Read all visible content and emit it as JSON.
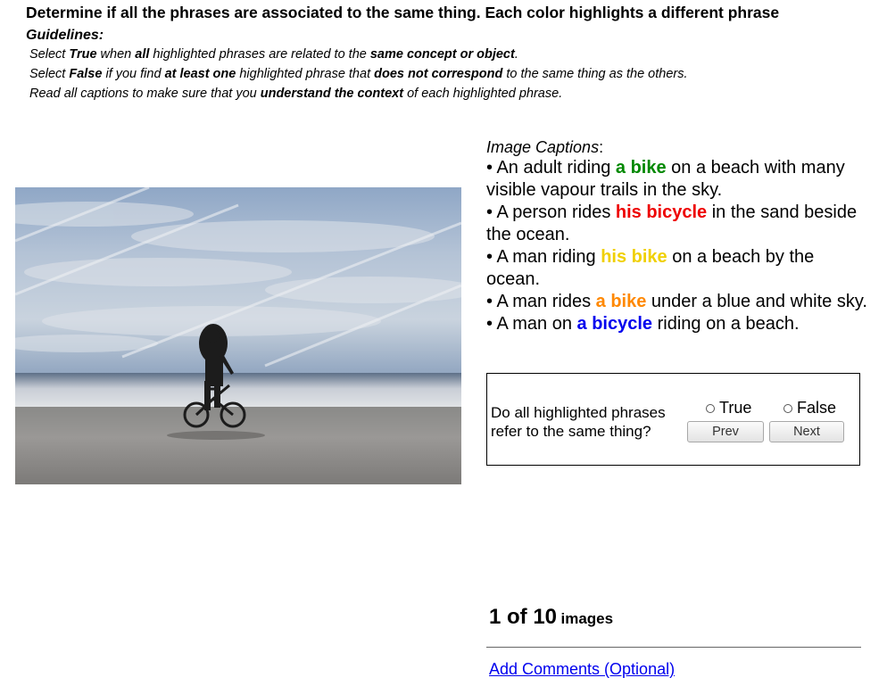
{
  "header": {
    "title": "Determine if all the phrases are associated to the same thing. Each color highlights a different phrase",
    "guidelines_label": "Guidelines:"
  },
  "guidelines": {
    "line1": {
      "a": "Select ",
      "b": "True",
      "c": " when ",
      "d": "all",
      "e": " highlighted phrases are related to the ",
      "f": "same concept or object",
      "g": "."
    },
    "line2": {
      "a": "Select ",
      "b": "False",
      "c": " if you find ",
      "d": "at least one",
      "e": " highlighted phrase that ",
      "f": "does not correspond",
      "g": " to the same thing as the others."
    },
    "line3": {
      "a": "Read all captions to make sure that you ",
      "b": "understand the context",
      "c": " of each highlighted phrase."
    }
  },
  "captions": {
    "heading": "Image Captions",
    "heading_suffix": ":",
    "items": [
      {
        "bullet": "• ",
        "before": "An adult riding ",
        "phrase": "a bike",
        "after": " on a beach with many visible vapour trails in the sky.",
        "color": "#008800"
      },
      {
        "bullet": "• ",
        "before": "A person rides ",
        "phrase": "his bicycle",
        "after": " in the sand beside the ocean.",
        "color": "#ee0000"
      },
      {
        "bullet": "• ",
        "before": "A man riding ",
        "phrase": "his bike",
        "after": " on a beach by the ocean.",
        "color": "#f0d000"
      },
      {
        "bullet": "• ",
        "before": "A man rides ",
        "phrase": "a bike",
        "after": " under a blue and white sky.",
        "color": "#ff8800"
      },
      {
        "bullet": "• ",
        "before": "A man on ",
        "phrase": "a bicycle",
        "after": " riding on a beach.",
        "color": "#0000ee"
      }
    ]
  },
  "question": {
    "text": "Do all highlighted phrases refer to the same thing?",
    "true_label": "True",
    "false_label": "False",
    "prev_label": "Prev",
    "next_label": "Next"
  },
  "progress": {
    "current_text": "1 of 10",
    "unit_text": "images",
    "current": 1,
    "total": 10
  },
  "footer": {
    "comments_link": "Add Comments (Optional)"
  }
}
